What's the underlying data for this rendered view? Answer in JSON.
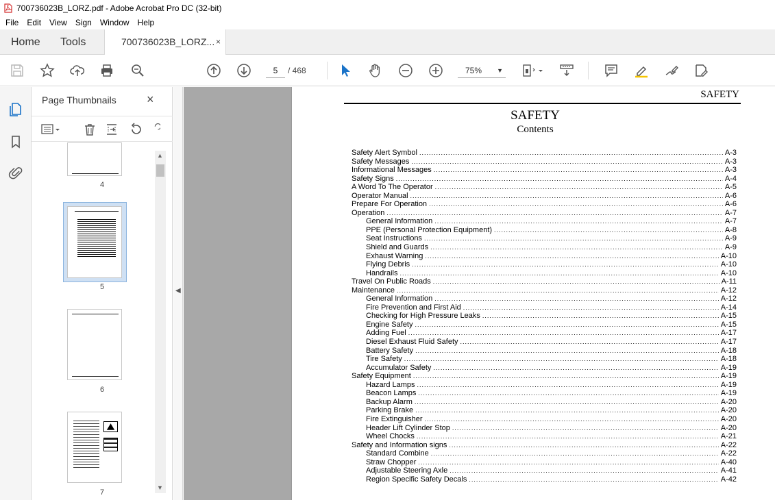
{
  "window": {
    "title": "700736023B_LORZ.pdf - Adobe Acrobat Pro DC (32-bit)"
  },
  "menu": [
    "File",
    "Edit",
    "View",
    "Sign",
    "Window",
    "Help"
  ],
  "tabs": {
    "home": "Home",
    "tools": "Tools",
    "document": "700736023B_LORZ...",
    "close_glyph": "×"
  },
  "toolbar": {
    "current_page": "5",
    "page_total": "/ 468",
    "zoom": "75%"
  },
  "thumbnail_panel": {
    "title": "Page Thumbnails",
    "close_glyph": "×",
    "thumbnails": [
      {
        "label": "4"
      },
      {
        "label": "5",
        "selected": true
      },
      {
        "label": "6"
      },
      {
        "label": "7"
      }
    ]
  },
  "document": {
    "running_header": "SAFETY",
    "title": "SAFETY",
    "subtitle": "Contents",
    "toc": [
      {
        "text": "Safety Alert Symbol",
        "page": "A-3",
        "level": 0
      },
      {
        "text": "Safety Messages",
        "page": "A-3",
        "level": 0
      },
      {
        "text": "Informational Messages",
        "page": "A-3",
        "level": 0
      },
      {
        "text": "Safety Signs",
        "page": "A-4",
        "level": 0
      },
      {
        "text": "A Word To The Operator",
        "page": "A-5",
        "level": 0
      },
      {
        "text": "Operator Manual",
        "page": "A-6",
        "level": 0
      },
      {
        "text": "Prepare For Operation",
        "page": "A-6",
        "level": 0
      },
      {
        "text": "Operation",
        "page": "A-7",
        "level": 0
      },
      {
        "text": "General Information",
        "page": "A-7",
        "level": 1
      },
      {
        "text": "PPE (Personal Protection Equipment)",
        "page": "A-8",
        "level": 1
      },
      {
        "text": "Seat Instructions",
        "page": "A-9",
        "level": 1
      },
      {
        "text": "Shield and Guards",
        "page": "A-9",
        "level": 1
      },
      {
        "text": "Exhaust Warning",
        "page": "A-10",
        "level": 1
      },
      {
        "text": "Flying Debris",
        "page": "A-10",
        "level": 1
      },
      {
        "text": "Handrails",
        "page": "A-10",
        "level": 1
      },
      {
        "text": "Travel On Public Roads",
        "page": "A-11",
        "level": 0
      },
      {
        "text": "Maintenance",
        "page": "A-12",
        "level": 0
      },
      {
        "text": "General Information",
        "page": "A-12",
        "level": 1
      },
      {
        "text": "Fire Prevention and First Aid",
        "page": "A-14",
        "level": 1
      },
      {
        "text": "Checking for High Pressure Leaks",
        "page": "A-15",
        "level": 1
      },
      {
        "text": "Engine Safety",
        "page": "A-15",
        "level": 1
      },
      {
        "text": "Adding Fuel",
        "page": "A-17",
        "level": 1
      },
      {
        "text": "Diesel Exhaust Fluid Safety",
        "page": "A-17",
        "level": 1
      },
      {
        "text": "Battery Safety",
        "page": "A-18",
        "level": 1
      },
      {
        "text": "Tire Safety",
        "page": "A-18",
        "level": 1
      },
      {
        "text": "Accumulator Safety",
        "page": "A-19",
        "level": 1
      },
      {
        "text": "Safety Equipment",
        "page": "A-19",
        "level": 0
      },
      {
        "text": "Hazard Lamps",
        "page": "A-19",
        "level": 1
      },
      {
        "text": "Beacon Lamps",
        "page": "A-19",
        "level": 1
      },
      {
        "text": "Backup Alarm",
        "page": "A-20",
        "level": 1
      },
      {
        "text": "Parking Brake",
        "page": "A-20",
        "level": 1
      },
      {
        "text": "Fire Extinguisher",
        "page": "A-20",
        "level": 1
      },
      {
        "text": "Header Lift Cylinder Stop",
        "page": "A-20",
        "level": 1
      },
      {
        "text": "Wheel Chocks",
        "page": "A-21",
        "level": 1
      },
      {
        "text": "Safety and Information signs",
        "page": "A-22",
        "level": 0
      },
      {
        "text": "Standard Combine",
        "page": "A-22",
        "level": 1
      },
      {
        "text": "Straw Chopper",
        "page": "A-40",
        "level": 1
      },
      {
        "text": "Adjustable Steering Axle",
        "page": "A-41",
        "level": 1
      },
      {
        "text": "Region Specific Safety Decals",
        "page": "A-42",
        "level": 1
      }
    ]
  }
}
